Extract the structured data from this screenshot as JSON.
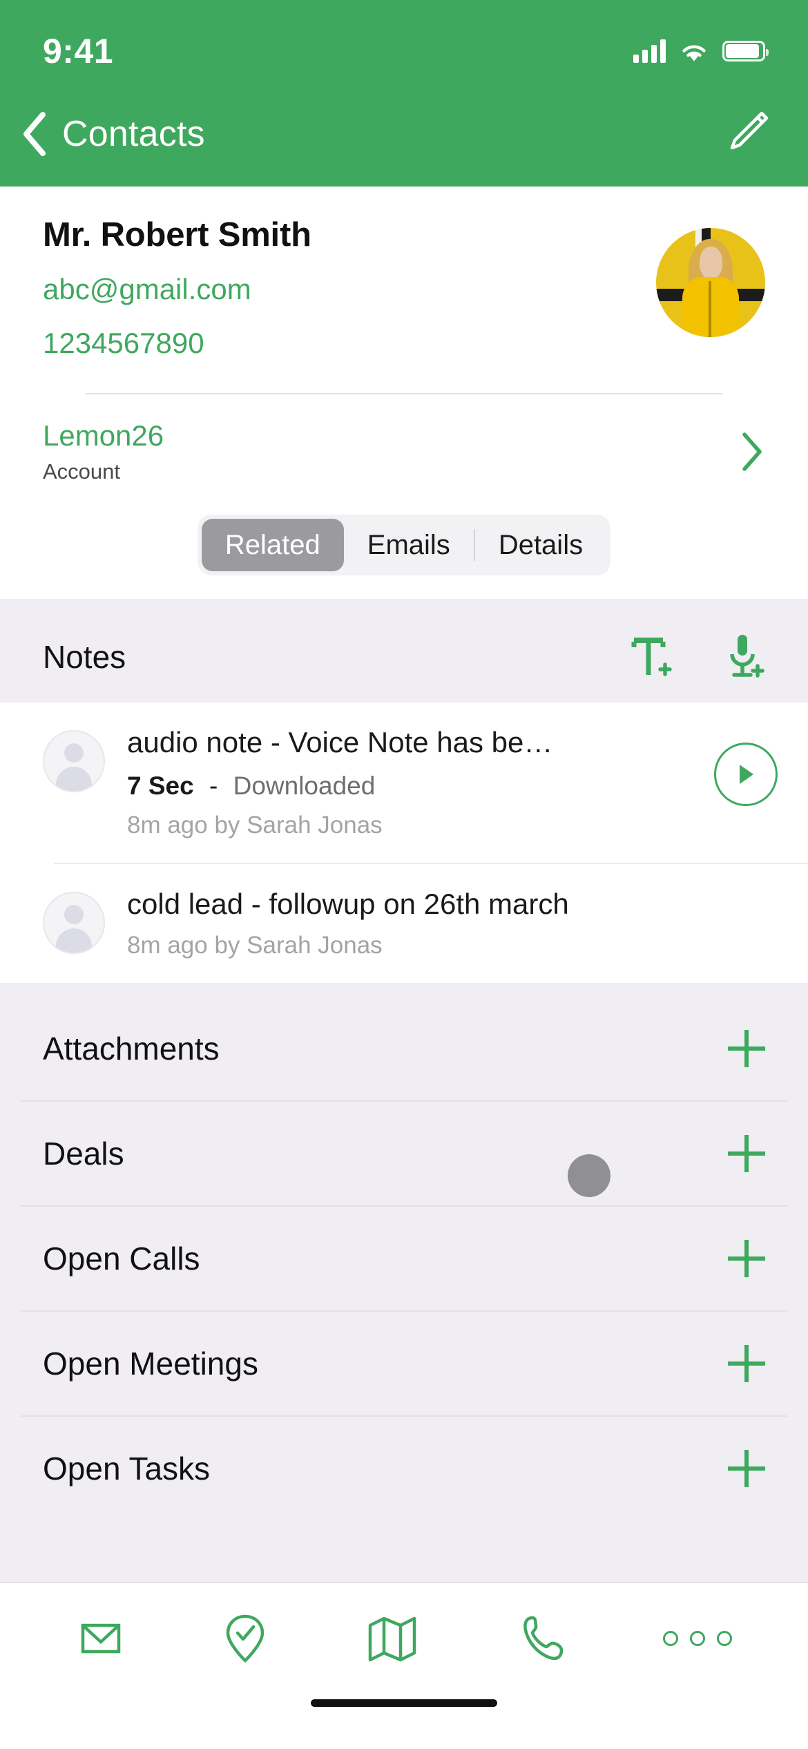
{
  "status_bar": {
    "time": "9:41",
    "cellular_icon": "signal-bars-icon",
    "wifi_icon": "wifi-icon",
    "battery_icon": "battery-icon"
  },
  "nav": {
    "back_label": "Contacts",
    "back_icon": "chevron-left-icon",
    "edit_icon": "pencil-edit-icon"
  },
  "contact": {
    "name": "Mr. Robert Smith",
    "email": "abc@gmail.com",
    "phone": "1234567890",
    "avatar_icon": "contact-photo"
  },
  "account": {
    "value": "Lemon26",
    "label": "Account",
    "chevron_icon": "chevron-right-icon"
  },
  "tabs": [
    {
      "label": "Related",
      "selected": true
    },
    {
      "label": "Emails",
      "selected": false
    },
    {
      "label": "Details",
      "selected": false
    }
  ],
  "notes": {
    "title": "Notes",
    "add_text_icon": "add-text-note-icon",
    "add_voice_icon": "add-voice-note-icon",
    "items": [
      {
        "title": "audio note - Voice Note has be…",
        "duration": "7 Sec",
        "separator": "-",
        "state": "Downloaded",
        "subtitle": "8m ago by Sarah Jonas",
        "has_play": true,
        "play_icon": "play-icon",
        "avatar_icon": "user-placeholder-icon"
      },
      {
        "title": "cold lead - followup on 26th march",
        "duration": "",
        "separator": "",
        "state": "",
        "subtitle": "8m ago by Sarah Jonas",
        "has_play": false,
        "play_icon": "",
        "avatar_icon": "user-placeholder-icon"
      }
    ]
  },
  "related_sections": [
    {
      "label": "Attachments",
      "add_icon": "plus-icon"
    },
    {
      "label": "Deals",
      "add_icon": "plus-icon"
    },
    {
      "label": "Open Calls",
      "add_icon": "plus-icon"
    },
    {
      "label": "Open Meetings",
      "add_icon": "plus-icon"
    },
    {
      "label": "Open Tasks",
      "add_icon": "plus-icon"
    }
  ],
  "toolbar": [
    {
      "name": "email",
      "icon": "envelope-icon"
    },
    {
      "name": "check-in",
      "icon": "map-pin-check-icon"
    },
    {
      "name": "map",
      "icon": "map-folded-icon"
    },
    {
      "name": "call",
      "icon": "phone-handset-icon"
    },
    {
      "name": "more",
      "icon": "more-horizontal-icon"
    }
  ],
  "colors": {
    "brand_green": "#3fa85f",
    "page_background": "#f0eef2",
    "card_background": "#ffffff",
    "selected_tab": "#9b9b9f",
    "cursor_dot": "#8f8f94"
  }
}
